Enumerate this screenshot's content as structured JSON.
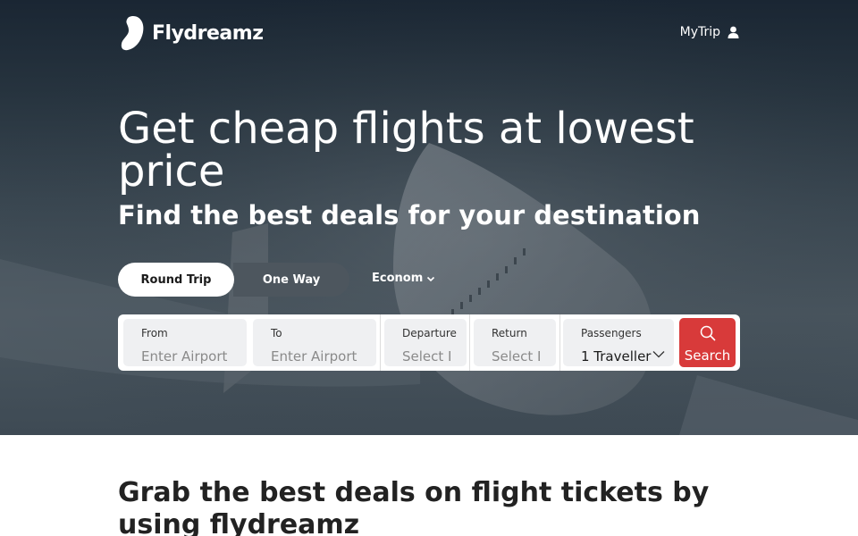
{
  "brand": {
    "name": "Flydreamz"
  },
  "header": {
    "mytrip_label": "MyTrip",
    "user_icon": "user-icon"
  },
  "hero": {
    "title": "Get cheap flights at lowest price",
    "subtitle": "Find the best deals for your destination"
  },
  "trip_type": {
    "round_trip": "Round Trip",
    "one_way": "One Way",
    "cabin": "Economy",
    "selected": "Round Trip"
  },
  "search": {
    "from": {
      "label": "From",
      "placeholder": "Enter Airport or City"
    },
    "to": {
      "label": "To",
      "placeholder": "Enter Airport or City"
    },
    "departure": {
      "label": "Departure",
      "placeholder": "Select Date"
    },
    "return": {
      "label": "Return",
      "placeholder": "Select Date"
    },
    "passengers": {
      "label": "Passengers",
      "value": "1 Traveller"
    },
    "button_label": "Search"
  },
  "deals": {
    "title": "Grab the best deals on flight tickets by using flydreamz"
  },
  "colors": {
    "accent": "#d83a3a",
    "hero_dark": "#1a2633",
    "field_bg": "#eff0f2"
  }
}
